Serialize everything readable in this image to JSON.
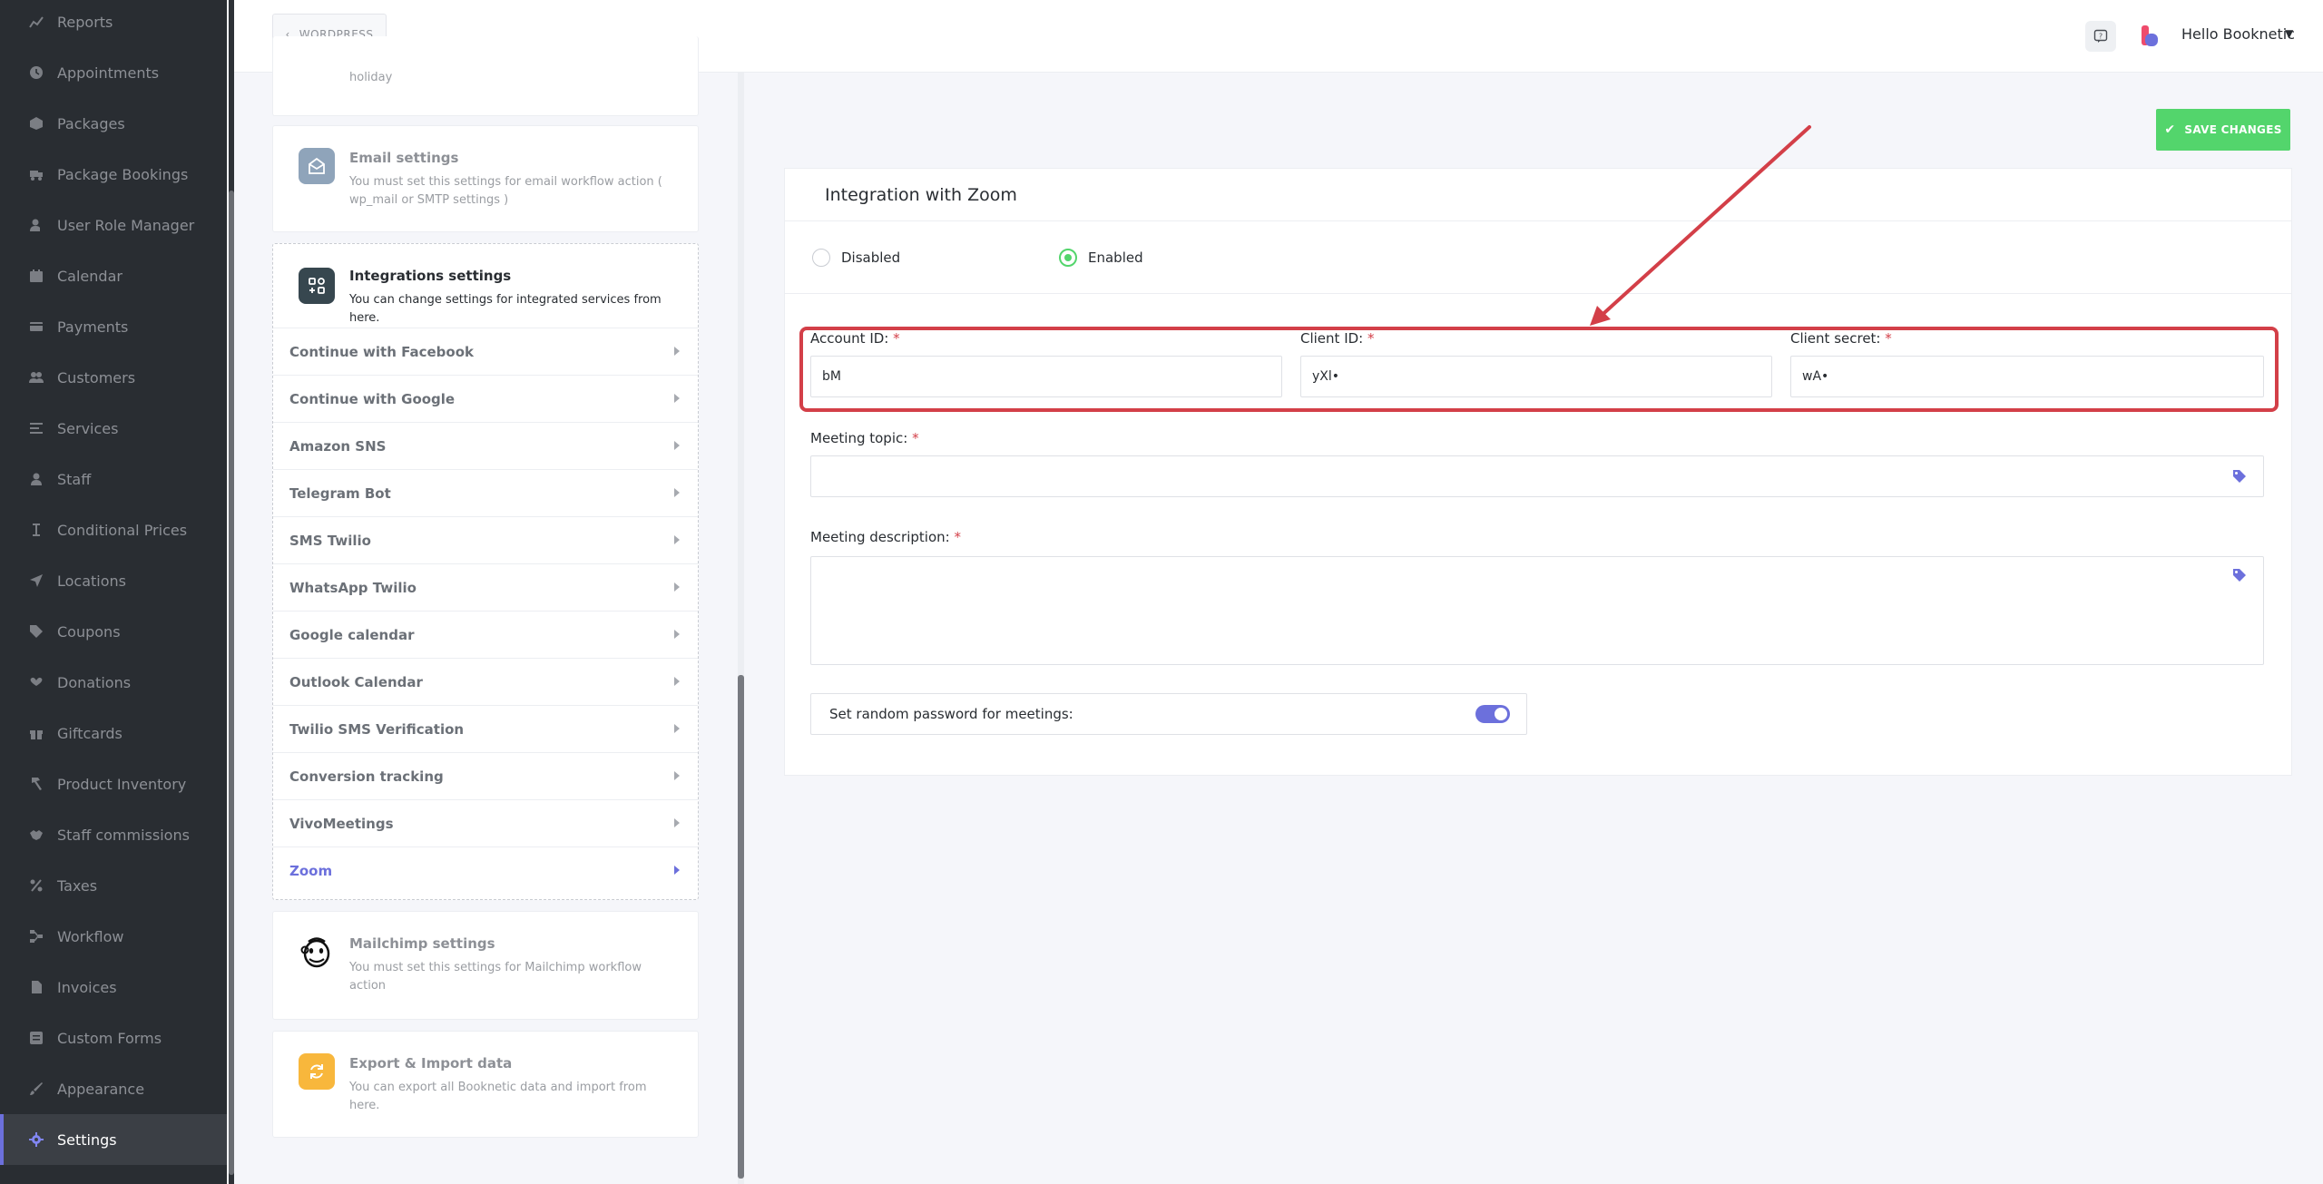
{
  "sidebar": {
    "items": [
      {
        "label": "Reports",
        "icon": "chart-line-icon"
      },
      {
        "label": "Appointments",
        "icon": "clock-icon"
      },
      {
        "label": "Packages",
        "icon": "box-icon"
      },
      {
        "label": "Package Bookings",
        "icon": "truck-icon"
      },
      {
        "label": "User Role Manager",
        "icon": "user-cog-icon"
      },
      {
        "label": "Calendar",
        "icon": "calendar-icon"
      },
      {
        "label": "Payments",
        "icon": "credit-card-icon"
      },
      {
        "label": "Customers",
        "icon": "users-icon"
      },
      {
        "label": "Services",
        "icon": "list-icon"
      },
      {
        "label": "Staff",
        "icon": "user-icon"
      },
      {
        "label": "Conditional Prices",
        "icon": "i-cursor-icon"
      },
      {
        "label": "Locations",
        "icon": "location-arrow-icon"
      },
      {
        "label": "Coupons",
        "icon": "tag-icon"
      },
      {
        "label": "Donations",
        "icon": "hand-heart-icon"
      },
      {
        "label": "Giftcards",
        "icon": "gift-icon"
      },
      {
        "label": "Product Inventory",
        "icon": "hammer-icon"
      },
      {
        "label": "Staff commissions",
        "icon": "handshake-icon"
      },
      {
        "label": "Taxes",
        "icon": "percent-icon"
      },
      {
        "label": "Workflow",
        "icon": "workflow-icon"
      },
      {
        "label": "Invoices",
        "icon": "file-invoice-icon"
      },
      {
        "label": "Custom Forms",
        "icon": "forms-icon"
      },
      {
        "label": "Appearance",
        "icon": "brush-icon"
      },
      {
        "label": "Settings",
        "icon": "gear-icon",
        "active": true
      }
    ]
  },
  "header": {
    "wordpress_label": "WORDPRESS",
    "greeting": "Hello Booknetic"
  },
  "settings_cards": {
    "holiday_desc_tail": "holiday",
    "email": {
      "title": "Email settings",
      "desc": "You must set this settings for email workflow action ( wp_mail or SMTP settings )"
    },
    "integrations": {
      "title": "Integrations settings",
      "desc": "You can change settings for integrated services from here.",
      "items": [
        "Continue with Facebook",
        "Continue with Google",
        "Amazon SNS",
        "Telegram Bot",
        "SMS Twilio",
        "WhatsApp Twilio",
        "Google calendar",
        "Outlook Calendar",
        "Twilio SMS Verification",
        "Conversion tracking",
        "VivoMeetings",
        "Zoom"
      ],
      "active_item": "Zoom"
    },
    "mailchimp": {
      "title": "Mailchimp settings",
      "desc": "You must set this settings for Mailchimp workflow action"
    },
    "export": {
      "title": "Export & Import data",
      "desc": "You can export all Booknetic data and import from here."
    }
  },
  "main": {
    "save_label": "SAVE CHANGES",
    "title": "Integration with Zoom",
    "radio_disabled": "Disabled",
    "radio_enabled": "Enabled",
    "selected": "Enabled",
    "account_id_label": "Account ID:",
    "account_id_value": "bM",
    "client_id_label": "Client ID:",
    "client_id_value": "yXl•",
    "client_secret_label": "Client secret:",
    "client_secret_value": "wA•",
    "required_mark": "*",
    "meeting_topic_label": "Meeting topic:",
    "meeting_topic_value": "",
    "meeting_desc_label": "Meeting description:",
    "meeting_desc_value": "",
    "random_pw_label": "Set random password for meetings:",
    "random_pw_enabled": true
  },
  "colors": {
    "accent": "#6c70dc",
    "save_green": "#53d56c",
    "annotation_red": "#d33f48",
    "sidebar_bg": "#292d32"
  }
}
